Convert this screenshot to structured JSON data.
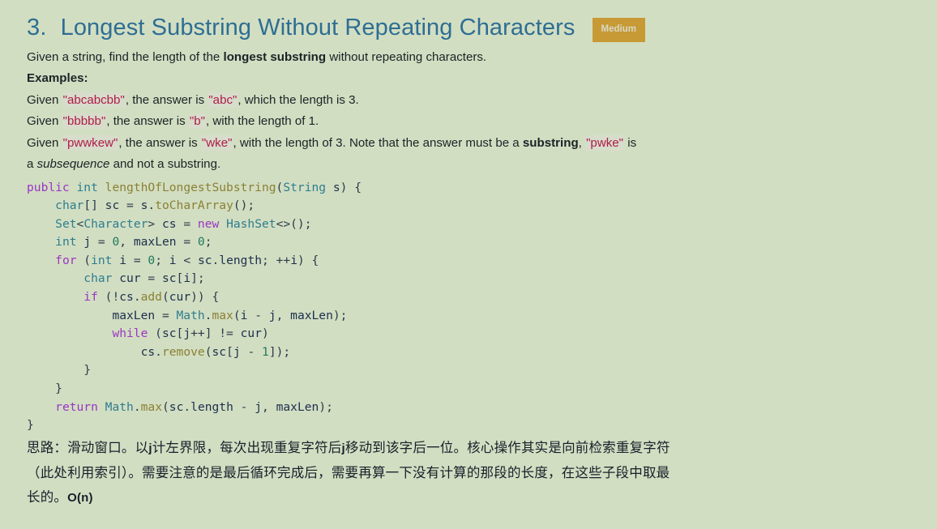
{
  "page": {
    "background_color": "#d2dec2",
    "title_color": "#2e6e93",
    "badge_color": "#c79a36",
    "inline_code_color": "#b01b4a",
    "inline_code_bg": "#d7dccb"
  },
  "header": {
    "number": "3.",
    "title": "Longest Substring Without Repeating Characters",
    "badge": "Medium"
  },
  "description": {
    "line1_a": "Given a string, find the length of the ",
    "line1_bold": "longest substring",
    "line1_b": " without repeating characters.",
    "examples_label": "Examples:",
    "examples": [
      {
        "a": "Given ",
        "code1": "\"abcabcbb\"",
        "b": ", the answer is ",
        "code2": "\"abc\"",
        "c": ", which the length is 3."
      },
      {
        "a": "Given ",
        "code1": "\"bbbbb\"",
        "b": ", the answer is ",
        "code2": "\"b\"",
        "c": ", with the length of 1."
      }
    ],
    "example3": {
      "a": "Given ",
      "code1": "\"pwwkew\"",
      "b": ", the answer is ",
      "code2": "\"wke\"",
      "c": ", with the length of 3. Note that the answer must be a ",
      "bold": "substring",
      "d": ", ",
      "code3": "\"pwke\"",
      "e": " is",
      "f_a": "a ",
      "f_italic": "subsequence",
      "f_b": " and not a substring."
    }
  },
  "code": {
    "language": "java",
    "lines": [
      [
        {
          "t": "public",
          "c": "kw"
        },
        {
          "t": " ",
          "c": "punc"
        },
        {
          "t": "int",
          "c": "typ"
        },
        {
          "t": " ",
          "c": "punc"
        },
        {
          "t": "lengthOfLongestSubstring",
          "c": "fn"
        },
        {
          "t": "(",
          "c": "punc"
        },
        {
          "t": "String",
          "c": "typ"
        },
        {
          "t": " ",
          "c": "punc"
        },
        {
          "t": "s",
          "c": "id"
        },
        {
          "t": ") {",
          "c": "punc"
        }
      ],
      [
        {
          "t": "    ",
          "c": "punc"
        },
        {
          "t": "char",
          "c": "typ"
        },
        {
          "t": "[] ",
          "c": "punc"
        },
        {
          "t": "sc",
          "c": "id"
        },
        {
          "t": " = ",
          "c": "punc"
        },
        {
          "t": "s",
          "c": "id"
        },
        {
          "t": ".",
          "c": "punc"
        },
        {
          "t": "toCharArray",
          "c": "fn"
        },
        {
          "t": "();",
          "c": "punc"
        }
      ],
      [
        {
          "t": "    ",
          "c": "punc"
        },
        {
          "t": "Set",
          "c": "typ"
        },
        {
          "t": "<",
          "c": "punc"
        },
        {
          "t": "Character",
          "c": "typ"
        },
        {
          "t": "> ",
          "c": "punc"
        },
        {
          "t": "cs",
          "c": "id"
        },
        {
          "t": " = ",
          "c": "punc"
        },
        {
          "t": "new",
          "c": "kw"
        },
        {
          "t": " ",
          "c": "punc"
        },
        {
          "t": "HashSet",
          "c": "typ"
        },
        {
          "t": "<>();",
          "c": "punc"
        }
      ],
      [
        {
          "t": "    ",
          "c": "punc"
        },
        {
          "t": "int",
          "c": "typ"
        },
        {
          "t": " ",
          "c": "punc"
        },
        {
          "t": "j",
          "c": "id"
        },
        {
          "t": " = ",
          "c": "punc"
        },
        {
          "t": "0",
          "c": "num"
        },
        {
          "t": ", ",
          "c": "punc"
        },
        {
          "t": "maxLen",
          "c": "id"
        },
        {
          "t": " = ",
          "c": "punc"
        },
        {
          "t": "0",
          "c": "num"
        },
        {
          "t": ";",
          "c": "punc"
        }
      ],
      [
        {
          "t": "    ",
          "c": "punc"
        },
        {
          "t": "for",
          "c": "kw"
        },
        {
          "t": " (",
          "c": "punc"
        },
        {
          "t": "int",
          "c": "typ"
        },
        {
          "t": " ",
          "c": "punc"
        },
        {
          "t": "i",
          "c": "id"
        },
        {
          "t": " = ",
          "c": "punc"
        },
        {
          "t": "0",
          "c": "num"
        },
        {
          "t": "; ",
          "c": "punc"
        },
        {
          "t": "i",
          "c": "id"
        },
        {
          "t": " < ",
          "c": "punc"
        },
        {
          "t": "sc",
          "c": "id"
        },
        {
          "t": ".",
          "c": "punc"
        },
        {
          "t": "length",
          "c": "id"
        },
        {
          "t": "; ++",
          "c": "punc"
        },
        {
          "t": "i",
          "c": "id"
        },
        {
          "t": ") {",
          "c": "punc"
        }
      ],
      [
        {
          "t": "        ",
          "c": "punc"
        },
        {
          "t": "char",
          "c": "typ"
        },
        {
          "t": " ",
          "c": "punc"
        },
        {
          "t": "cur",
          "c": "id"
        },
        {
          "t": " = ",
          "c": "punc"
        },
        {
          "t": "sc",
          "c": "id"
        },
        {
          "t": "[",
          "c": "punc"
        },
        {
          "t": "i",
          "c": "id"
        },
        {
          "t": "];",
          "c": "punc"
        }
      ],
      [
        {
          "t": "        ",
          "c": "punc"
        },
        {
          "t": "if",
          "c": "kw"
        },
        {
          "t": " (!",
          "c": "punc"
        },
        {
          "t": "cs",
          "c": "id"
        },
        {
          "t": ".",
          "c": "punc"
        },
        {
          "t": "add",
          "c": "fn"
        },
        {
          "t": "(",
          "c": "punc"
        },
        {
          "t": "cur",
          "c": "id"
        },
        {
          "t": ")) {",
          "c": "punc"
        }
      ],
      [
        {
          "t": "            ",
          "c": "punc"
        },
        {
          "t": "maxLen",
          "c": "id"
        },
        {
          "t": " = ",
          "c": "punc"
        },
        {
          "t": "Math",
          "c": "typ"
        },
        {
          "t": ".",
          "c": "punc"
        },
        {
          "t": "max",
          "c": "fn"
        },
        {
          "t": "(",
          "c": "punc"
        },
        {
          "t": "i",
          "c": "id"
        },
        {
          "t": " - ",
          "c": "punc"
        },
        {
          "t": "j",
          "c": "id"
        },
        {
          "t": ", ",
          "c": "punc"
        },
        {
          "t": "maxLen",
          "c": "id"
        },
        {
          "t": ");",
          "c": "punc"
        }
      ],
      [
        {
          "t": "            ",
          "c": "punc"
        },
        {
          "t": "while",
          "c": "kw"
        },
        {
          "t": " (",
          "c": "punc"
        },
        {
          "t": "sc",
          "c": "id"
        },
        {
          "t": "[",
          "c": "punc"
        },
        {
          "t": "j",
          "c": "id"
        },
        {
          "t": "++] != ",
          "c": "punc"
        },
        {
          "t": "cur",
          "c": "id"
        },
        {
          "t": ")",
          "c": "punc"
        }
      ],
      [
        {
          "t": "                ",
          "c": "punc"
        },
        {
          "t": "cs",
          "c": "id"
        },
        {
          "t": ".",
          "c": "punc"
        },
        {
          "t": "remove",
          "c": "fn"
        },
        {
          "t": "(",
          "c": "punc"
        },
        {
          "t": "sc",
          "c": "id"
        },
        {
          "t": "[",
          "c": "punc"
        },
        {
          "t": "j",
          "c": "id"
        },
        {
          "t": " - ",
          "c": "punc"
        },
        {
          "t": "1",
          "c": "num"
        },
        {
          "t": "]);",
          "c": "punc"
        }
      ],
      [
        {
          "t": "        }",
          "c": "punc"
        }
      ],
      [
        {
          "t": "    }",
          "c": "punc"
        }
      ],
      [
        {
          "t": "    ",
          "c": "punc"
        },
        {
          "t": "return",
          "c": "kw"
        },
        {
          "t": " ",
          "c": "punc"
        },
        {
          "t": "Math",
          "c": "typ"
        },
        {
          "t": ".",
          "c": "punc"
        },
        {
          "t": "max",
          "c": "fn"
        },
        {
          "t": "(",
          "c": "punc"
        },
        {
          "t": "sc",
          "c": "id"
        },
        {
          "t": ".",
          "c": "punc"
        },
        {
          "t": "length",
          "c": "id"
        },
        {
          "t": " - ",
          "c": "punc"
        },
        {
          "t": "j",
          "c": "id"
        },
        {
          "t": ", ",
          "c": "punc"
        },
        {
          "t": "maxLen",
          "c": "id"
        },
        {
          "t": ");",
          "c": "punc"
        }
      ],
      [
        {
          "t": "}",
          "c": "punc"
        }
      ]
    ]
  },
  "note": {
    "l1_a": "思路：滑动窗口。以",
    "l1_j1": "j",
    "l1_b": "计左界限，每次出现重复字符后",
    "l1_j2": "j",
    "l1_c": "移动到该字后一位。核心操作其实是向前检索重复字符",
    "l2": "（此处利用索引）。需要注意的是最后循环完成后，需要再算一下没有计算的那段的长度，在这些子段中取最",
    "l3_a": "长的。",
    "l3_big_o": "O(n)"
  }
}
